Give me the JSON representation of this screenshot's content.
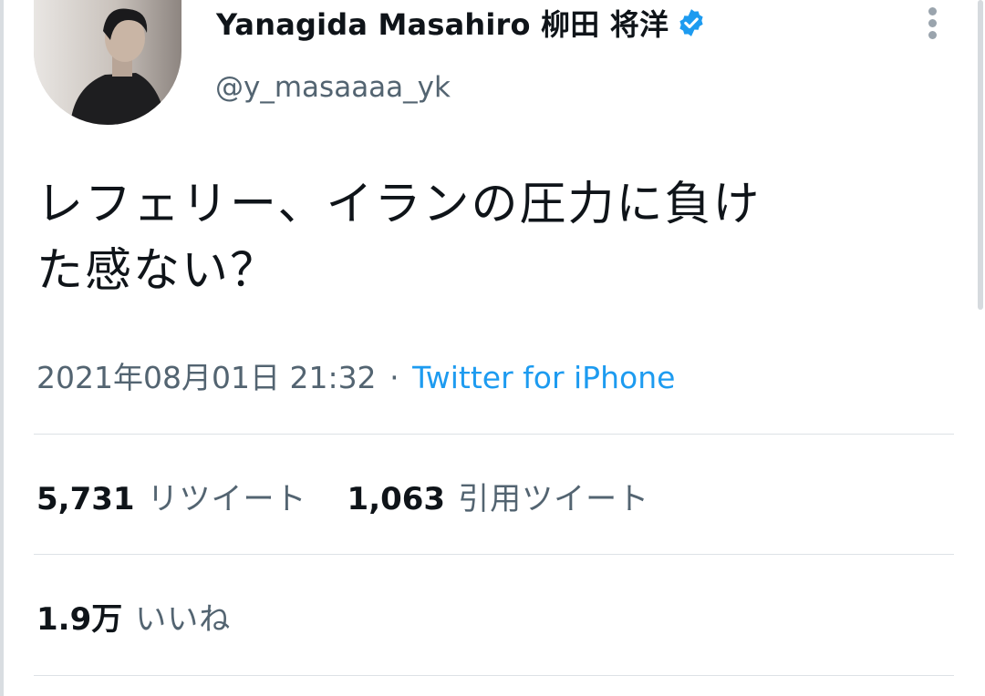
{
  "user": {
    "display_name": "Yanagida Masahiro 柳田 将洋",
    "handle": "@y_masaaaa_yk",
    "verified": true
  },
  "tweet": {
    "text_line1": "レフェリー、イランの圧力に負け",
    "text_line2": "た感ない？",
    "timestamp": "2021年08月01日 21:32",
    "separator": "·",
    "source": "Twitter for iPhone"
  },
  "stats": {
    "retweets_count": "5,731",
    "retweets_label": "リツイート",
    "quotes_count": "1,063",
    "quotes_label": "引用ツイート",
    "likes_count": "1.9万",
    "likes_label": "いいね"
  },
  "colors": {
    "text_primary": "#0f1419",
    "text_secondary": "#536471",
    "accent": "#1d9bf0",
    "divider": "#dde2e6"
  },
  "icons": {
    "verified": "verified-badge-icon",
    "more": "more-vertical-icon"
  }
}
